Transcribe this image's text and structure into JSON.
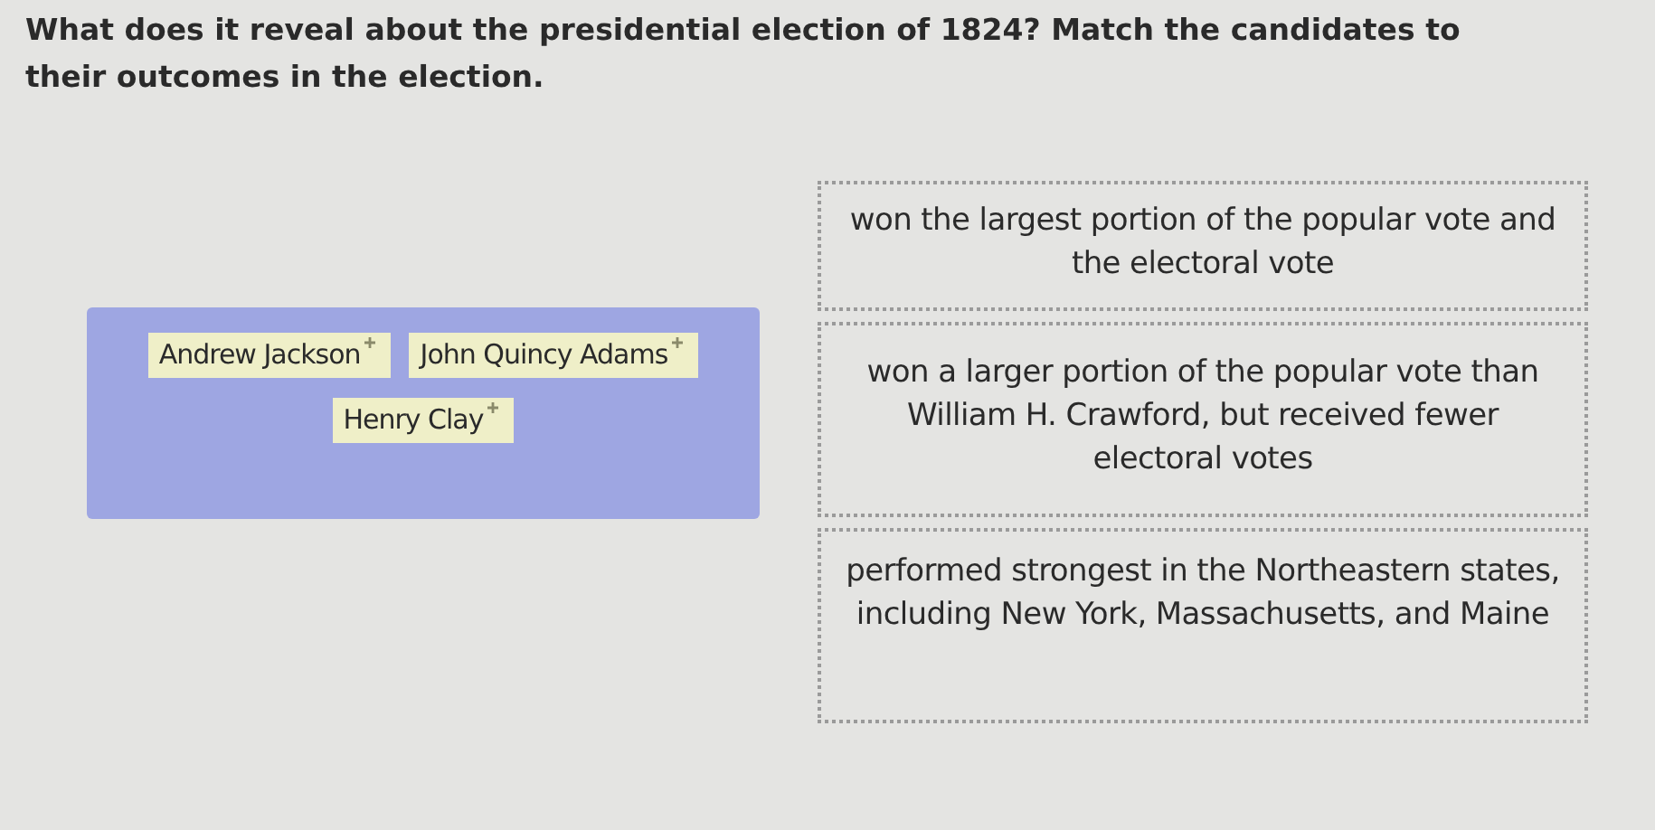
{
  "question": "What does it reveal about the presidential election of 1824? Match the candidates to their outcomes in the election.",
  "candidates": [
    {
      "label": "Andrew Jackson"
    },
    {
      "label": "John Quincy Adams"
    },
    {
      "label": "Henry Clay"
    }
  ],
  "outcomes": [
    {
      "text": "won the largest portion of the popular vote and the electoral vote"
    },
    {
      "text": "won a larger portion of the popular vote than William H. Crawford, but received fewer electoral votes"
    },
    {
      "text": "performed strongest in the Northeastern states, including New York, Massachusetts, and Maine"
    }
  ]
}
